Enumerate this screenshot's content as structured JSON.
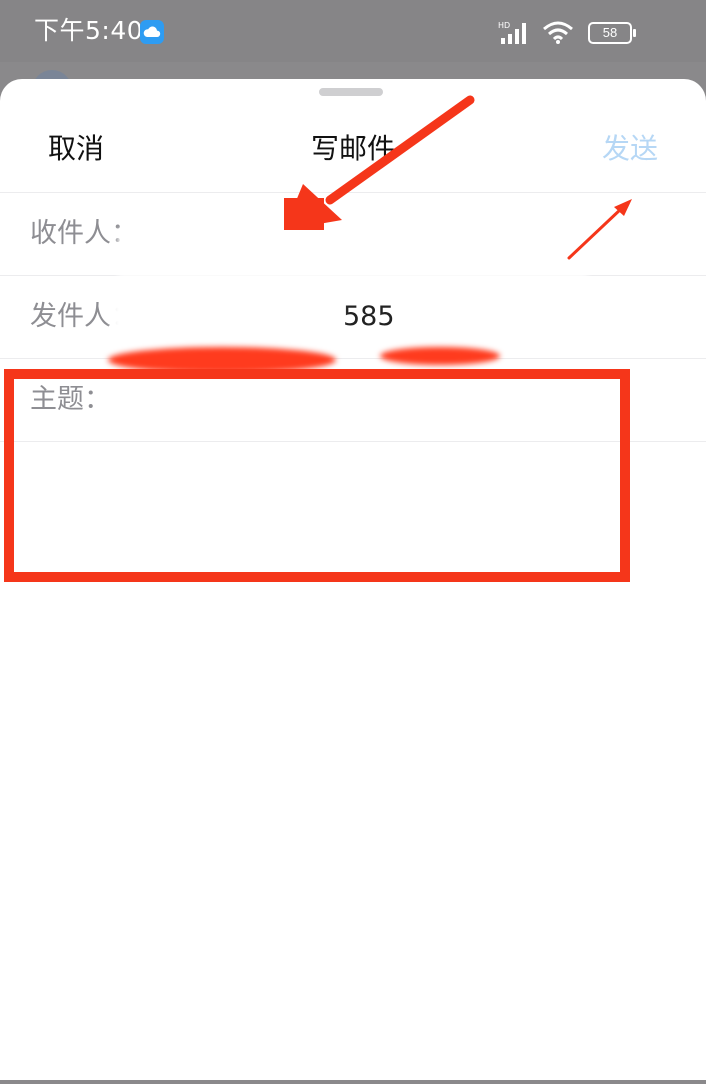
{
  "status_bar": {
    "time": "下午5:40",
    "network_tag": "HD",
    "battery": "58"
  },
  "compose": {
    "cancel_label": "取消",
    "title": "写邮件",
    "send_label": "发送",
    "to_label": "收件人：",
    "from_label": "发件人：",
    "from_value": "585  ...om>",
    "subject_label": "主题："
  },
  "colors": {
    "accent_send_disabled": "#b6d7f5",
    "annotation_red": "#f5361a",
    "status_bar_bg": "#868587"
  },
  "icons": {
    "status_cloud": "cloud-icon",
    "signal": "signal-icon",
    "wifi": "wifi-icon",
    "battery": "battery-icon"
  }
}
